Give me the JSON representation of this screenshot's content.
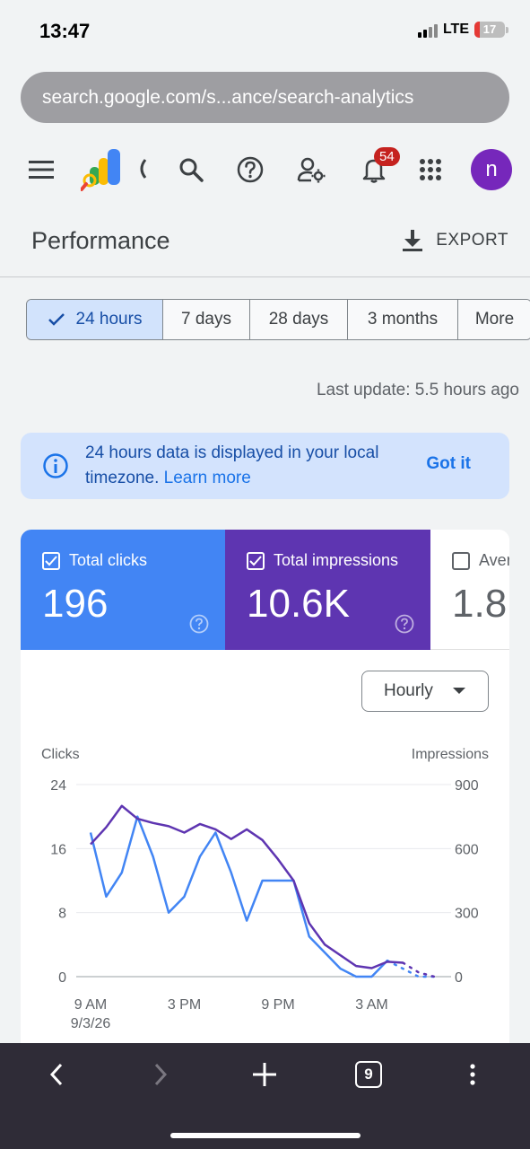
{
  "status_bar": {
    "time": "13:47",
    "network": "LTE",
    "battery": "17",
    "battery_level": 0.17
  },
  "browser": {
    "url": "search.google.com/s...ance/search-analytics"
  },
  "app_bar": {
    "icons": [
      "menu-icon",
      "search-console-logo",
      "search-icon",
      "help-icon",
      "user-settings-icon",
      "notifications-icon",
      "apps-grid-icon"
    ],
    "notification_count": "54",
    "avatar_letter": "n"
  },
  "page": {
    "title": "Performance",
    "export_label": "EXPORT"
  },
  "date_range": {
    "chips": [
      {
        "label": "24 hours",
        "selected": true
      },
      {
        "label": "7 days",
        "selected": false
      },
      {
        "label": "28 days",
        "selected": false
      },
      {
        "label": "3 months",
        "selected": false
      },
      {
        "label": "More",
        "selected": false
      }
    ]
  },
  "last_update": "Last update: 5.5 hours ago",
  "info_banner": {
    "text": "24 hours data is displayed in your local timezone.",
    "link": "Learn more",
    "action": "Got it"
  },
  "metrics": [
    {
      "label": "Total clicks",
      "value": "196",
      "checked": true,
      "color": "#4285f4"
    },
    {
      "label": "Total impressions",
      "value": "10.6K",
      "checked": true,
      "color": "#5e35b1"
    },
    {
      "label": "Aver",
      "value": "1.8",
      "checked": false,
      "color": "#ffffff"
    }
  ],
  "granularity": {
    "selected": "Hourly"
  },
  "chart_data": {
    "type": "line",
    "left_axis_label": "Clicks",
    "right_axis_label": "Impressions",
    "left_ylim": [
      0,
      24
    ],
    "right_ylim": [
      0,
      900
    ],
    "left_ticks": [
      "24",
      "16",
      "8",
      "0"
    ],
    "right_ticks": [
      "900",
      "600",
      "300",
      "0"
    ],
    "x_tick_labels": [
      "9 AM",
      "3 PM",
      "9 PM",
      "3 AM"
    ],
    "x_sublabel": "9/3/26",
    "x_hours_since_9am": [
      0,
      1,
      2,
      3,
      4,
      5,
      6,
      7,
      8,
      9,
      10,
      11,
      12,
      13,
      14,
      15,
      16,
      17,
      18,
      19,
      20,
      21,
      22
    ],
    "series": [
      {
        "axis": "left",
        "color": "#4285f4",
        "values": [
          18,
          10,
          13,
          20,
          15,
          8,
          10,
          15,
          18,
          13,
          7,
          12,
          12,
          12,
          5,
          3,
          1,
          0,
          0,
          2,
          1,
          0,
          0
        ],
        "dotted_from_index": 19
      },
      {
        "axis": "right",
        "color": "#5e35b1",
        "values": [
          620,
          700,
          800,
          740,
          720,
          705,
          675,
          715,
          690,
          645,
          690,
          640,
          550,
          450,
          250,
          150,
          100,
          50,
          40,
          70,
          65,
          20,
          0
        ],
        "dotted_from_index": 20
      }
    ],
    "grid": true
  },
  "bottom_nav": {
    "tab_count": "9"
  }
}
